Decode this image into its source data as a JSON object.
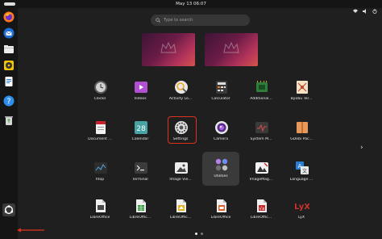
{
  "topbar": {
    "clock": "May 13  06:07"
  },
  "search": {
    "placeholder": "Type to search"
  },
  "dock": [
    {
      "name": "firefox-dock-icon"
    },
    {
      "name": "thunderbird-dock-icon"
    },
    {
      "name": "files-dock-icon"
    },
    {
      "name": "rhythmbox-dock-icon"
    },
    {
      "name": "writer-dock-icon"
    },
    {
      "name": "help-dock-icon"
    },
    {
      "name": "trash-dock-icon"
    },
    {
      "name": "show-apps-dock-icon"
    }
  ],
  "apps": [
    {
      "label": "Clocks"
    },
    {
      "label": "Videos"
    },
    {
      "label": "Activity Lo..."
    },
    {
      "label": "Calculator"
    },
    {
      "label": "Additional..."
    },
    {
      "label": "Byobu Ter..."
    },
    {
      "label": "Document ..."
    },
    {
      "label": "Calendar",
      "date": "28"
    },
    {
      "label": "Settings"
    },
    {
      "label": "Camera"
    },
    {
      "label": "System M..."
    },
    {
      "label": "GDebi Pac..."
    },
    {
      "label": "htop"
    },
    {
      "label": "Terminal"
    },
    {
      "label": "Image Vie..."
    },
    {
      "label": "Utilities"
    },
    {
      "label": "ImageMag..."
    },
    {
      "label": "Language ..."
    },
    {
      "label": "LibreOffice"
    },
    {
      "label": "LibreOffic..."
    },
    {
      "label": "LibreOffic..."
    },
    {
      "label": "LibreOffice"
    },
    {
      "label": "LibreOffic..."
    },
    {
      "label": "LyX"
    }
  ],
  "colors": {
    "highlight": "#e0301e",
    "panel": "#151515",
    "background": "#1f1f1f"
  }
}
